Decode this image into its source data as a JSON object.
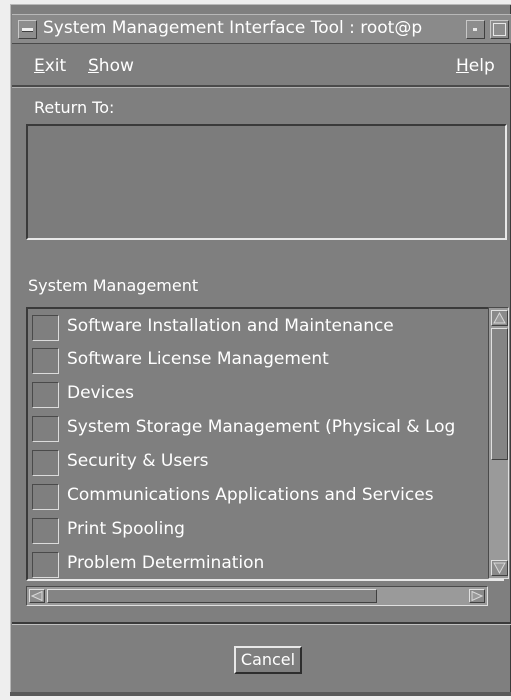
{
  "window": {
    "title": "System Management Interface Tool : root@p"
  },
  "menubar": {
    "exit": "Exit",
    "show": "Show",
    "help": "Help"
  },
  "return_to": {
    "label": "Return To:"
  },
  "system_management": {
    "label": "System Management",
    "items": [
      {
        "label": "Software Installation and Maintenance"
      },
      {
        "label": "Software License Management"
      },
      {
        "label": "Devices"
      },
      {
        "label": "System Storage Management (Physical & Log"
      },
      {
        "label": "Security & Users"
      },
      {
        "label": "Communications Applications and Services"
      },
      {
        "label": "Print Spooling"
      },
      {
        "label": "Problem Determination"
      }
    ]
  },
  "buttons": {
    "cancel": "Cancel"
  },
  "colors": {
    "window_bg": "#7f7f7f",
    "text": "#ffffff",
    "outer_bg": "#eeeeee"
  },
  "icons": [
    "window-menu-icon",
    "minimize-icon",
    "maximize-icon",
    "scroll-up-arrow-icon",
    "scroll-down-arrow-icon",
    "scroll-left-arrow-icon",
    "scroll-right-arrow-icon"
  ]
}
